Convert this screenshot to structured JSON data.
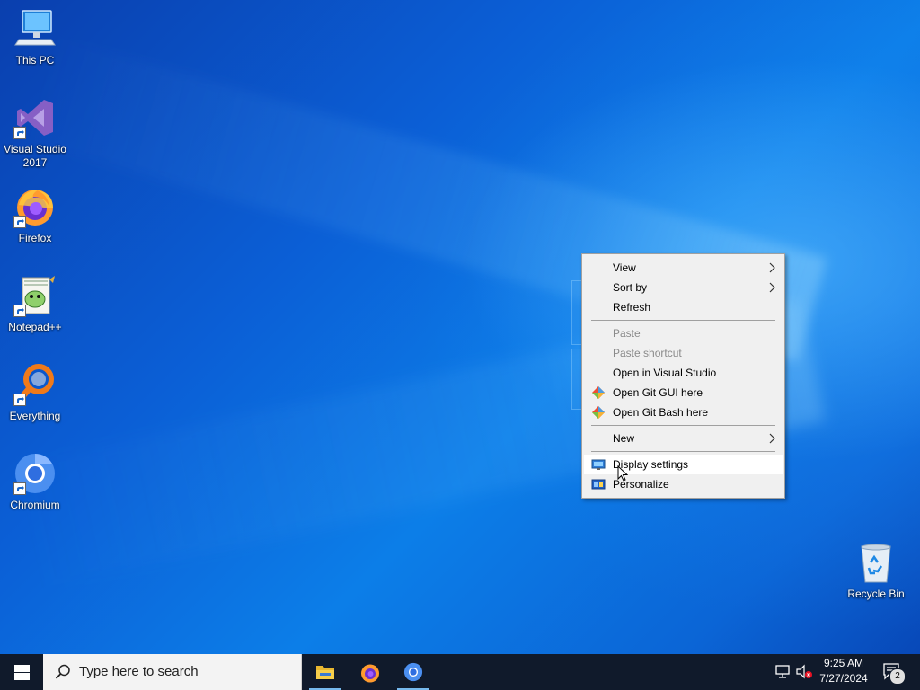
{
  "desktop": {
    "icons": [
      {
        "label": "This PC",
        "icon": "this-pc-icon"
      },
      {
        "label": "Visual Studio 2017",
        "icon": "visual-studio-icon"
      },
      {
        "label": "Firefox",
        "icon": "firefox-icon"
      },
      {
        "label": "Notepad++",
        "icon": "notepadpp-icon"
      },
      {
        "label": "Everything",
        "icon": "everything-icon"
      },
      {
        "label": "Chromium",
        "icon": "chromium-icon"
      },
      {
        "label": "Recycle Bin",
        "icon": "recycle-bin-icon"
      }
    ]
  },
  "context_menu": {
    "items": [
      {
        "label": "View",
        "submenu": true,
        "enabled": true
      },
      {
        "label": "Sort by",
        "submenu": true,
        "enabled": true
      },
      {
        "label": "Refresh",
        "enabled": true
      },
      {
        "label": "Paste",
        "enabled": false
      },
      {
        "label": "Paste shortcut",
        "enabled": false
      },
      {
        "label": "Open in Visual Studio",
        "enabled": true
      },
      {
        "label": "Open Git GUI here",
        "enabled": true,
        "icon": "git-icon"
      },
      {
        "label": "Open Git Bash here",
        "enabled": true,
        "icon": "git-icon"
      },
      {
        "label": "New",
        "submenu": true,
        "enabled": true
      },
      {
        "label": "Display settings",
        "enabled": true,
        "icon": "display-icon",
        "highlighted": true
      },
      {
        "label": "Personalize",
        "enabled": true,
        "icon": "personalize-icon"
      }
    ]
  },
  "taskbar": {
    "search_placeholder": "Type here to search",
    "pinned": [
      "file-explorer-icon",
      "firefox-icon",
      "chromium-icon"
    ],
    "clock": {
      "time": "9:25 AM",
      "date": "7/27/2024"
    },
    "notifications_count": "2"
  },
  "colors": {
    "taskbar_bg": "#101a2b",
    "menu_bg": "#f0f0f0",
    "accent": "#0078d7"
  }
}
